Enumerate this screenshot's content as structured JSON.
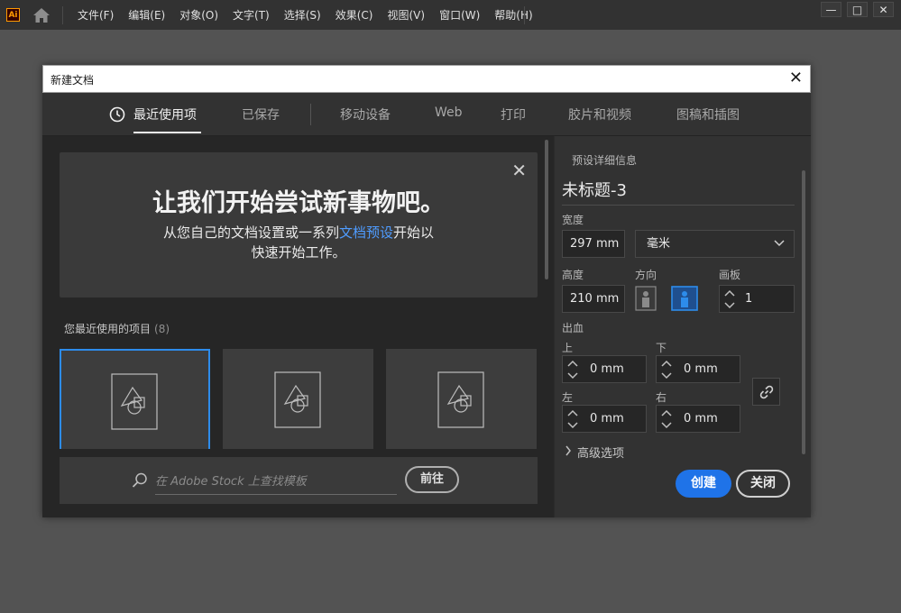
{
  "app": {
    "logo": "Ai",
    "menu": [
      "文件(F)",
      "编辑(E)",
      "对象(O)",
      "文字(T)",
      "选择(S)",
      "效果(C)",
      "视图(V)",
      "窗口(W)",
      "帮助(H)"
    ],
    "window_controls": {
      "minimize": "—",
      "maximize": "□",
      "close": "✕"
    }
  },
  "dialog": {
    "title": "新建文档",
    "close_glyph": "✕",
    "tabs": [
      "最近使用项",
      "已保存",
      "移动设备",
      "Web",
      "打印",
      "胶片和视频",
      "图稿和插图"
    ],
    "active_tab": "最近使用项"
  },
  "hero": {
    "heading": "让我们开始尝试新事物吧。",
    "text_before": "从您自己的文档设置或一系列",
    "link": "文档预设",
    "text_after": "开始以",
    "line2": "快速开始工作。",
    "close_glyph": "✕"
  },
  "recent": {
    "label": "您最近使用的项目",
    "count": "(8)"
  },
  "stock": {
    "placeholder": "在 Adobe Stock 上查找模板",
    "go_label": "前往"
  },
  "preset": {
    "section_label": "预设详细信息",
    "doc_name": "未标题-3",
    "width_label": "宽度",
    "width_value": "297 mm",
    "unit_value": "毫米",
    "height_label": "高度",
    "height_value": "210 mm",
    "orientation_label": "方向",
    "artboards_label": "画板",
    "artboards_value": "1",
    "bleed_label": "出血",
    "top_label": "上",
    "top_value": "0 mm",
    "bottom_label": "下",
    "bottom_value": "0 mm",
    "left_label": "左",
    "left_value": "0 mm",
    "right_label": "右",
    "right_value": "0 mm",
    "advanced_label": "高级选项",
    "create_label": "创建",
    "close_label": "关闭"
  },
  "colors": {
    "accent": "#1f73e8",
    "link": "#4f9cff",
    "selected_border": "#2d8ceb"
  }
}
